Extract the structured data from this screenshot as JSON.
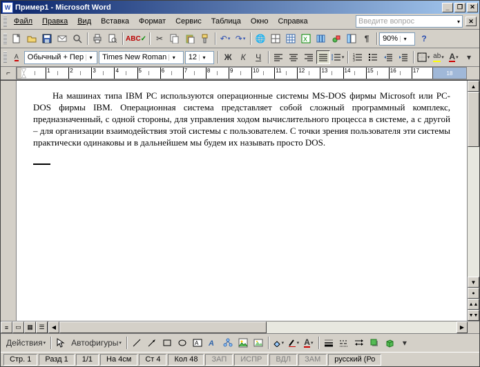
{
  "title": "Пример1 - Microsoft Word",
  "menus": [
    "Файл",
    "Правка",
    "Вид",
    "Вставка",
    "Формат",
    "Сервис",
    "Таблица",
    "Окно",
    "Справка"
  ],
  "help_placeholder": "Введите вопрос",
  "style": "Обычный + Пер",
  "font": "Times New Roman",
  "font_size": "12",
  "zoom": "90%",
  "ruler_numbers": [
    "1",
    "2",
    "3",
    "4",
    "5",
    "6",
    "7",
    "8",
    "9",
    "10",
    "11",
    "12",
    "13",
    "14",
    "15",
    "16",
    "17"
  ],
  "ruler_right": "18",
  "document_text": "На машинах типа IBM PC используются операционные системы MS-DOS фирмы Microsoft или PC-DOS фирмы IBM. Операционная система представляет собой сложный программный комплекс, предназначенный, с одной стороны, для управления ходом вычислительного процесса в системе, а с другой – для организации взаимодействия этой системы с пользователем. С точки зрения пользователя эти системы практически одинаковы и в дальнейшем мы будем их называть просто DOS.",
  "draw_menu": "Действия",
  "autoshapes": "Автофигуры",
  "status": {
    "page": "Стр. 1",
    "section": "Разд 1",
    "pages": "1/1",
    "at": "На 4см",
    "line": "Ст 4",
    "col": "Кол 48",
    "rec": "ЗАП",
    "trk": "ИСПР",
    "ext": "ВДЛ",
    "ovr": "ЗАМ",
    "lang": "русский (Ро"
  },
  "chart_data": null
}
